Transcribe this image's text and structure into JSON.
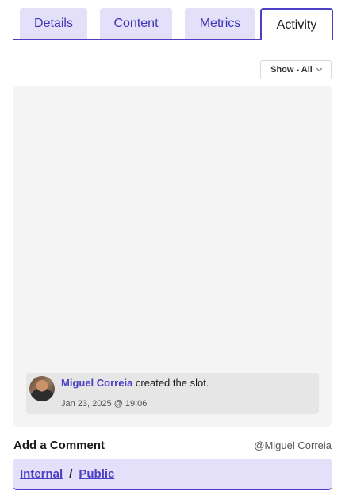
{
  "tabs": [
    {
      "label": "Details"
    },
    {
      "label": "Content"
    },
    {
      "label": "Metrics"
    },
    {
      "label": "Activity",
      "active": true
    }
  ],
  "filter": {
    "label": "Show - All",
    "icon": "chevron-down-icon"
  },
  "activity": [
    {
      "user": "Miguel Correia",
      "action": "created the slot.",
      "timestamp": "Jan 23, 2025 @ 19:06",
      "avatar": "user-avatar"
    }
  ],
  "comment": {
    "title": "Add a Comment",
    "user": "@Miguel Correia",
    "visibility": {
      "internal": "Internal",
      "separator": "/",
      "public": "Public"
    }
  },
  "colors": {
    "accent": "#4b3fc4",
    "tab_bg": "#e4e0fa",
    "panel_bg": "#f4f4f4",
    "entry_bg": "#e6e6e6"
  }
}
